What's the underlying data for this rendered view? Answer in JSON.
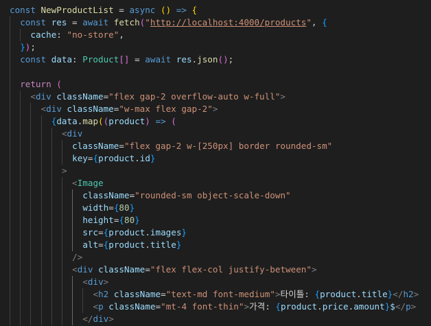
{
  "editor": {
    "language": "tsx",
    "colors": {
      "background": "#1e1e1e",
      "keyword": "#569cd6",
      "control": "#c586c0",
      "function": "#dcdcaa",
      "variable": "#9cdcfe",
      "string": "#ce9178",
      "type": "#4ec9b0",
      "number": "#b5cea8"
    },
    "lines": [
      "const NewProductList = async () => {",
      "  const res = await fetch(\"http://localhost:4000/products\", {",
      "    cache: \"no-store\",",
      "  });",
      "  const data: Product[] = await res.json();",
      "",
      "  return (",
      "    <div className=\"flex gap-2 overflow-auto w-full\">",
      "      <div className=\"w-max flex gap-2\">",
      "        {data.map((product) => (",
      "          <div",
      "            className=\"flex gap-2 w-[250px] border rounded-sm\"",
      "            key={product.id}",
      "          >",
      "            <Image",
      "              className=\"rounded-sm object-scale-down\"",
      "              width={80}",
      "              height={80}",
      "              src={product.images}",
      "              alt={product.title}",
      "            />",
      "            <div className=\"flex flex-col justify-between\">",
      "              <div>",
      "                <h2 className=\"text-md font-medium\">타이틀: {product.title}</h2>",
      "                <p className=\"mt-4 font-thin\">가격: {product.price.amount}$</p>",
      "              </div>"
    ]
  }
}
